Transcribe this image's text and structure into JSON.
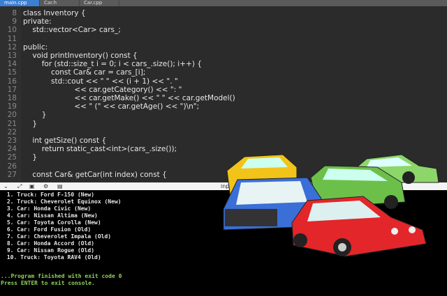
{
  "tabs": [
    "main.cpp",
    "Car.h",
    "Car.cpp"
  ],
  "code": [
    {
      "n": "8",
      "t": "class Inventory {"
    },
    {
      "n": "9",
      "t": "private:"
    },
    {
      "n": "10",
      "t": "    std::vector<Car> cars_;"
    },
    {
      "n": "11",
      "t": ""
    },
    {
      "n": "12",
      "t": "public:"
    },
    {
      "n": "13",
      "t": "    void printInventory() const {"
    },
    {
      "n": "14",
      "t": "        for (std::size_t i = 0; i < cars_.size(); i++) {"
    },
    {
      "n": "15",
      "t": "            const Car& car = cars_[i];"
    },
    {
      "n": "16",
      "t": "            std::cout << \" \" << (i + 1) << \". \""
    },
    {
      "n": "17",
      "t": "                      << car.getCategory() << \": \""
    },
    {
      "n": "18",
      "t": "                      << car.getMake() << \" \" << car.getModel()"
    },
    {
      "n": "19",
      "t": "                      << \" (\" << car.getAge() << \")\\n\";"
    },
    {
      "n": "20",
      "t": "        }"
    },
    {
      "n": "21",
      "t": "    }"
    },
    {
      "n": "22",
      "t": ""
    },
    {
      "n": "23",
      "t": "    int getSize() const {"
    },
    {
      "n": "24",
      "t": "        return static_cast<int>(cars_.size());"
    },
    {
      "n": "25",
      "t": "    }"
    },
    {
      "n": "26",
      "t": ""
    },
    {
      "n": "27",
      "t": "    const Car& getCar(int index) const {"
    }
  ],
  "toolbar": {
    "input_label": "input"
  },
  "console": {
    "lines": [
      " 1. Truck: Ford F-150 (New)",
      " 2. Truck: Cheverolet Equinox (New)",
      " 3. Car: Honda Civic (New)",
      " 4. Car: Nissan Altima (New)",
      " 5. Car: Toyota Corolla (New)",
      " 6. Car: Ford Fusion (Old)",
      " 7. Car: Cheverolet Impala (Old)",
      " 8. Car: Honda Accord (Old)",
      " 9. Car: Nissan Rogue (Old)",
      " 10. Truck: Toyota RAV4 (Old)"
    ],
    "finished": "...Program finished with exit code 0",
    "prompt": "Press ENTER to exit console."
  },
  "colors": {
    "tab_active": "#3b7fd1",
    "editor_bg": "#2b2b2b",
    "console_text_green": "#8fd15a",
    "cars": [
      "#f2c318",
      "#6cc04a",
      "#3a6fd8",
      "#e3262a",
      "#8cd66a"
    ]
  }
}
